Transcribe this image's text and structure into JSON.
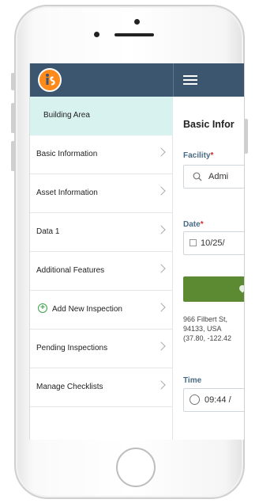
{
  "sidebar": {
    "header_label": "Building Area",
    "items": [
      {
        "label": "Basic Information"
      },
      {
        "label": "Asset Information"
      },
      {
        "label": "Data 1"
      },
      {
        "label": "Additional Features"
      },
      {
        "label": "Add New Inspection",
        "icon": "plus-circle-icon"
      },
      {
        "label": "Pending Inspections"
      },
      {
        "label": "Manage Checklists"
      }
    ]
  },
  "content": {
    "title": "Basic Infor",
    "facility": {
      "label": "Facility",
      "required": "*",
      "value": "Admi"
    },
    "date": {
      "label": "Date",
      "required": "*",
      "value": "10/25/"
    },
    "address_lines": [
      "966 Filbert St,",
      "94133, USA",
      "(37.80, -122.42"
    ],
    "time": {
      "label": "Time",
      "value": "09:44 /"
    }
  },
  "colors": {
    "topbar": "#3d5670",
    "sidebar_header": "#d8f2ef",
    "accent_green": "#5b8a33",
    "logo_orange": "#ff8a1c",
    "label_blue": "#4a6b85",
    "required_red": "#d62828"
  }
}
